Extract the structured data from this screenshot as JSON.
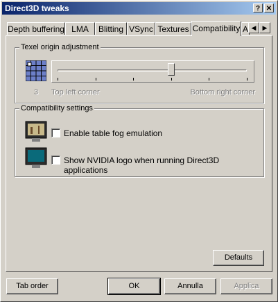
{
  "window": {
    "title": "Direct3D tweaks",
    "help_label": "?",
    "close_label": "✕"
  },
  "tabs": [
    {
      "label": "Depth buffering",
      "active": false
    },
    {
      "label": "LMA",
      "active": false
    },
    {
      "label": "Blitting",
      "active": false
    },
    {
      "label": "VSync",
      "active": false
    },
    {
      "label": "Textures",
      "active": false
    },
    {
      "label": "Compatibility",
      "active": true
    },
    {
      "label": "A",
      "active": false
    }
  ],
  "tab_scroll": {
    "left_label": "◀",
    "right_label": "▶"
  },
  "texel_group": {
    "label": "Texel origin adjustment",
    "slider_value": 3,
    "slider_fraction": 0.6,
    "value_label": "3",
    "min_label": "Top left corner",
    "max_label": "Bottom right corner"
  },
  "compat_group": {
    "label": "Compatibility settings",
    "options": [
      {
        "label": "Enable table fog emulation",
        "checked": false
      },
      {
        "label": "Show NVIDIA logo when running Direct3D applications",
        "checked": false
      }
    ]
  },
  "buttons": {
    "defaults": "Defaults",
    "tab_order": "Tab order",
    "ok": "OK",
    "cancel": "Annulla",
    "apply": "Applica"
  }
}
